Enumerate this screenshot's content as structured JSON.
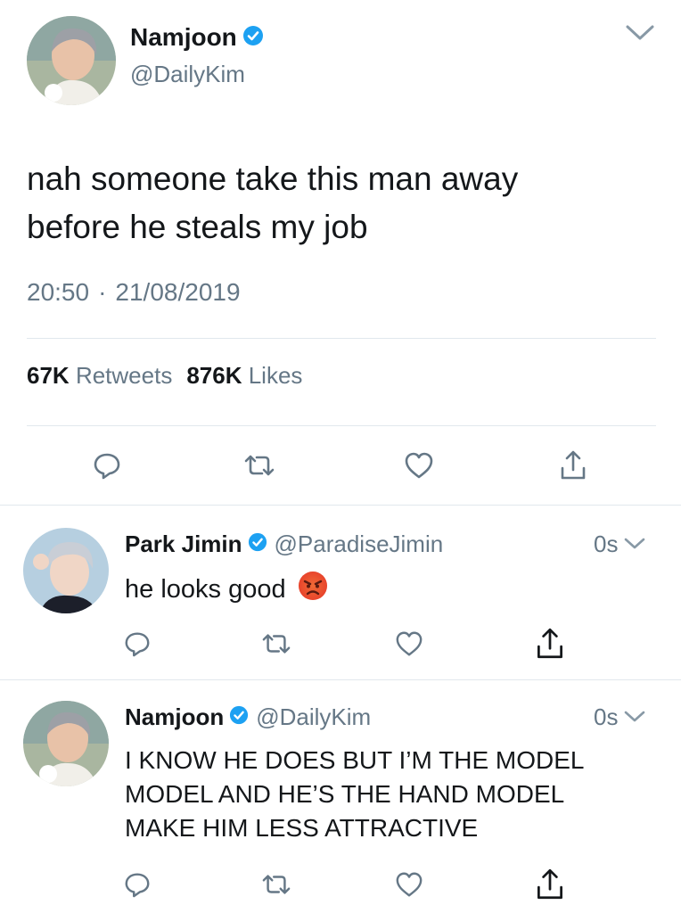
{
  "main_tweet": {
    "author_name": "Namjoon",
    "author_handle": "@DailyKim",
    "text_line1": "nah someone take this man away",
    "text_line2": "before he steals my job",
    "time": "20:50",
    "separator": "·",
    "date": "21/08/2019",
    "retweets_count": "67K",
    "retweets_label": "Retweets",
    "likes_count": "876K",
    "likes_label": "Likes"
  },
  "replies": [
    {
      "author_name": "Park Jimin",
      "author_handle": "@ParadiseJimin",
      "time": "0s",
      "text": "he looks good",
      "emoji": "😡"
    },
    {
      "author_name": "Namjoon",
      "author_handle": "@DailyKim",
      "time": "0s",
      "text_line1": "I KNOW HE DOES BUT I’M THE MODEL",
      "text_line2": "MODEL AND HE’S THE HAND MODEL",
      "text_line3": "MAKE HIM LESS ATTRACTIVE"
    }
  ],
  "colors": {
    "verified": "#1da1f2",
    "text": "#14171a",
    "secondary": "#657786",
    "divider": "#e1e8ed"
  },
  "icons": [
    "chevron-down-icon",
    "verified-badge-icon",
    "reply-icon",
    "retweet-icon",
    "like-icon",
    "share-icon"
  ]
}
